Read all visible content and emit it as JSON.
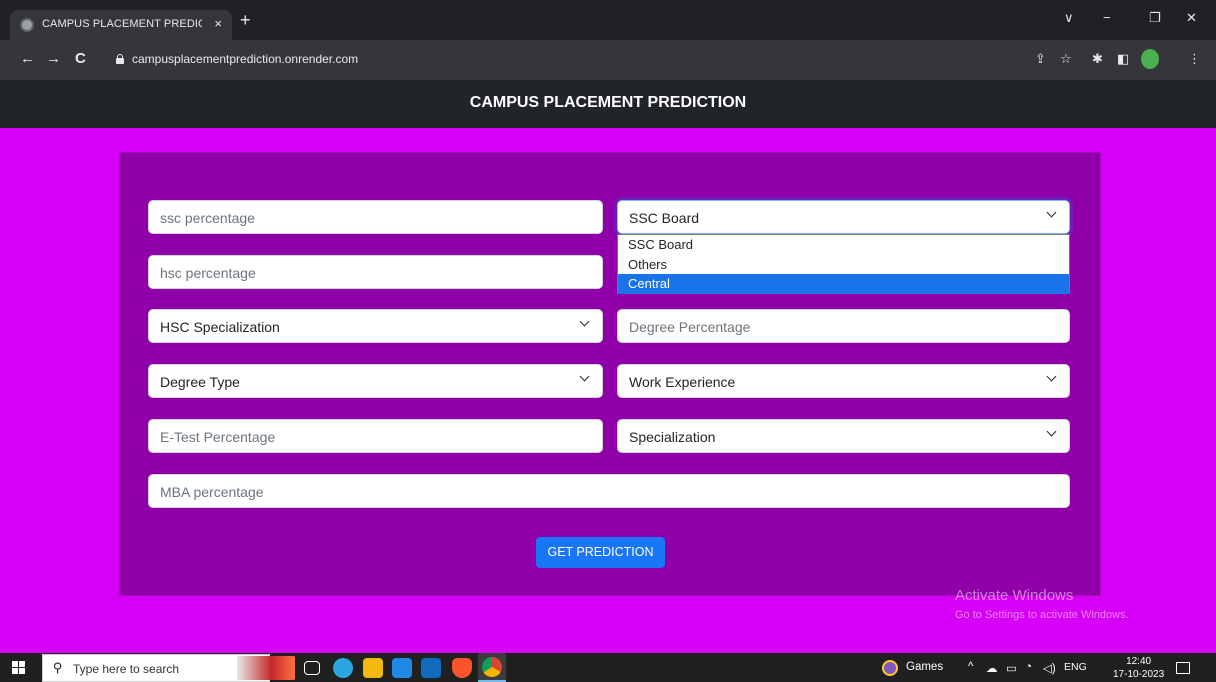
{
  "browser": {
    "tab_title": "CAMPUS PLACEMENT PREDICTI",
    "tab_close": "×",
    "new_tab": "+",
    "url": "campusplacementprediction.onrender.com",
    "nav": {
      "back": "←",
      "forward": "→",
      "reload": "C"
    },
    "window_controls": {
      "tab_list": "∨",
      "minimize": "−",
      "restore": "❐",
      "close": "✕"
    },
    "toolbar_icons": {
      "share": "⇪",
      "bookmark": "☆",
      "extensions": "✱",
      "sidepanel": "◧",
      "menu": "⋮"
    }
  },
  "page": {
    "title": "CAMPUS PLACEMENT PREDICTION",
    "fields": {
      "ssc_percentage": {
        "placeholder": "ssc percentage"
      },
      "ssc_board": {
        "value": "SSC Board"
      },
      "hsc_percentage": {
        "placeholder": "hsc percentage"
      },
      "hsc_specialization": {
        "value": "HSC Specialization"
      },
      "degree_percentage": {
        "placeholder": "Degree Percentage"
      },
      "degree_type": {
        "value": "Degree Type"
      },
      "work_experience": {
        "value": "Work Experience"
      },
      "etest_percentage": {
        "placeholder": "E-Test Percentage"
      },
      "specialization": {
        "value": "Specialization"
      },
      "mba_percentage": {
        "placeholder": "MBA percentage"
      }
    },
    "ssc_board_options": [
      "SSC Board",
      "Others",
      "Central"
    ],
    "ssc_board_highlighted": "Central",
    "submit_label": "GET PREDICTION",
    "watermark": {
      "title": "Activate Windows",
      "subtitle": "Go to Settings to activate Windows."
    }
  },
  "taskbar": {
    "search_placeholder": "Type here to search",
    "games_label": "Games",
    "tray_up": "^",
    "language": "ENG",
    "time": "12:40",
    "date": "17-10-2023"
  },
  "colors": {
    "page_bg": "#d600f7",
    "card_bg": "#9000a8",
    "navbar_bg": "#212529",
    "button_bg": "#1976f7",
    "option_highlight": "#1a73e8"
  }
}
